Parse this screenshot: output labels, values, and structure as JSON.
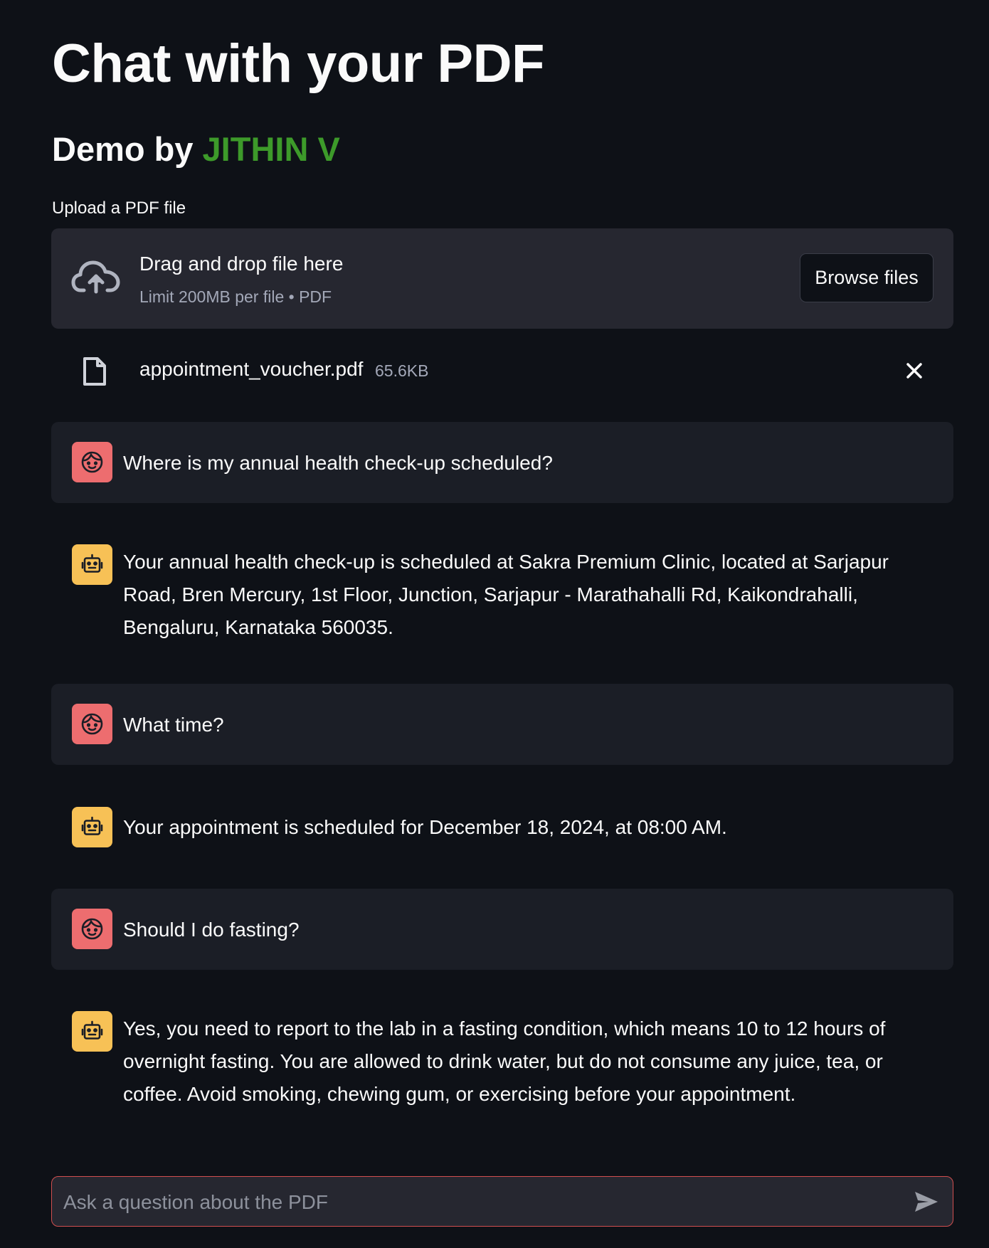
{
  "header": {
    "title": "Chat with your PDF",
    "subtitle_prefix": "Demo by ",
    "subtitle_author": "JITHIN V",
    "author_color": "#3d9a2a"
  },
  "uploader": {
    "label": "Upload a PDF file",
    "dropzone_title": "Drag and drop file here",
    "dropzone_hint": "Limit 200MB per file • PDF",
    "browse_label": "Browse files",
    "icon": "cloud-upload-icon"
  },
  "uploaded_file": {
    "name": "appointment_voucher.pdf",
    "size": "65.6KB",
    "icon": "file-icon",
    "remove_icon": "close-icon"
  },
  "messages": [
    {
      "role": "user",
      "avatar_icon": "user-face-icon",
      "avatar_color": "#ed6d6f",
      "text": "Where is my annual health check-up scheduled?"
    },
    {
      "role": "assistant",
      "avatar_icon": "robot-icon",
      "avatar_color": "#f7c156",
      "text": "Your annual health check-up is scheduled at Sakra Premium Clinic, located at Sarjapur Road, Bren Mercury, 1st Floor, Junction, Sarjapur - Marathahalli Rd, Kaikondrahalli, Bengaluru, Karnataka 560035."
    },
    {
      "role": "user",
      "avatar_icon": "user-face-icon",
      "avatar_color": "#ed6d6f",
      "text": "What time?"
    },
    {
      "role": "assistant",
      "avatar_icon": "robot-icon",
      "avatar_color": "#f7c156",
      "text": "Your appointment is scheduled for December 18, 2024, at 08:00 AM."
    },
    {
      "role": "user",
      "avatar_icon": "user-face-icon",
      "avatar_color": "#ed6d6f",
      "text": "Should I do fasting?"
    },
    {
      "role": "assistant",
      "avatar_icon": "robot-icon",
      "avatar_color": "#f7c156",
      "text": "Yes, you need to report to the lab in a fasting condition, which means 10 to 12 hours of overnight fasting. You are allowed to drink water, but do not consume any juice, tea, or coffee. Avoid smoking, chewing gum, or exercising before your appointment."
    }
  ],
  "chat_input": {
    "placeholder": "Ask a question about the PDF",
    "value": "",
    "send_icon": "send-icon"
  }
}
